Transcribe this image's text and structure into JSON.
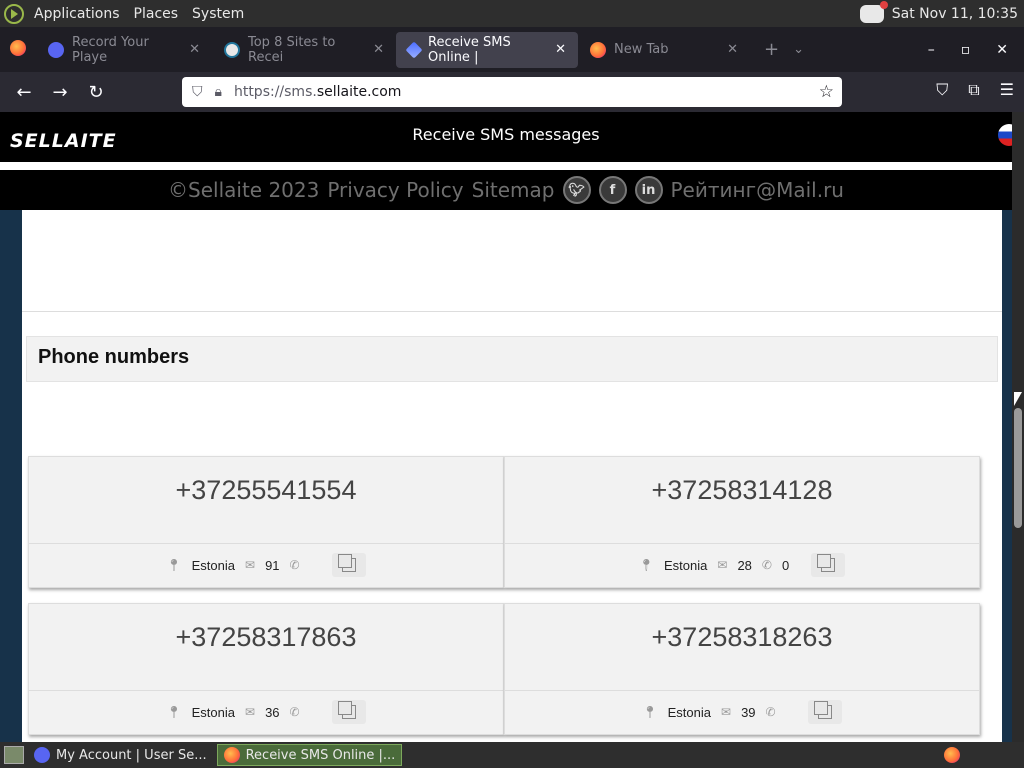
{
  "system_panel": {
    "menus": [
      "Applications",
      "Places",
      "System"
    ],
    "clock": "Sat Nov 11, 10:35"
  },
  "browser": {
    "tabs": [
      {
        "label": "Record Your Playe",
        "icon": "discord-icon",
        "active": false
      },
      {
        "label": "Top 8 Sites to Recei",
        "icon": "wordpress-icon",
        "active": false
      },
      {
        "label": "Receive SMS Online |",
        "icon": "sellaite-icon",
        "active": true
      },
      {
        "label": "New Tab",
        "icon": "firefox-icon",
        "active": false
      }
    ],
    "url_prefix": "https://sms.",
    "url_domain": "sellaite.com"
  },
  "site": {
    "logo": "SELLAITE",
    "header_title": "Receive SMS messages",
    "footer": {
      "copyright": "©Sellaite 2023",
      "privacy": "Privacy Policy",
      "sitemap": "Sitemap",
      "rating": "Рейтинг@Mail.ru"
    },
    "section_title": "Phone numbers",
    "numbers": [
      {
        "number": "+37255541554",
        "country": "Estonia",
        "messages": "91",
        "calls": ""
      },
      {
        "number": "+37258314128",
        "country": "Estonia",
        "messages": "28",
        "calls": "0"
      },
      {
        "number": "+37258317863",
        "country": "Estonia",
        "messages": "36",
        "calls": ""
      },
      {
        "number": "+37258318263",
        "country": "Estonia",
        "messages": "39",
        "calls": ""
      }
    ]
  },
  "taskbar": {
    "items": [
      {
        "label": "My Account | User Se...",
        "icon": "discord-icon",
        "active": false
      },
      {
        "label": "Receive SMS Online |...",
        "icon": "firefox-icon",
        "active": true
      }
    ]
  }
}
